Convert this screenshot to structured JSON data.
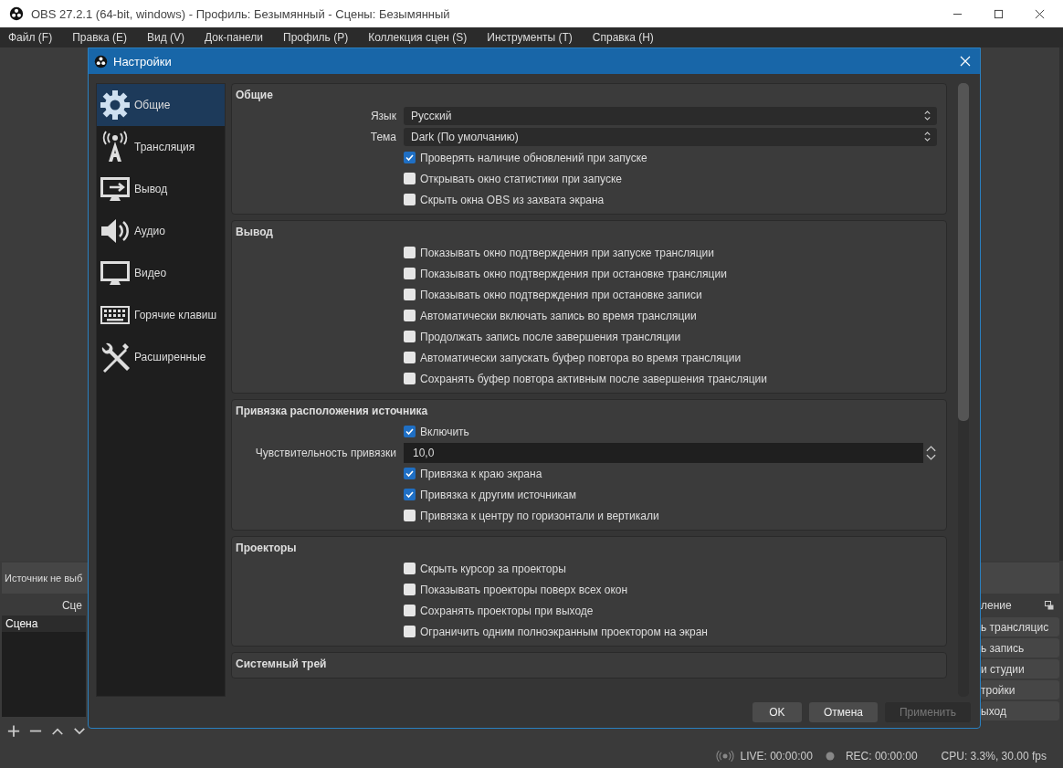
{
  "window": {
    "title": "OBS 27.2.1 (64-bit, windows) - Профиль: Безымянный - Сцены: Безымянный"
  },
  "menu": [
    "Файл (F)",
    "Правка (E)",
    "Вид (V)",
    "Док-панели",
    "Профиль (P)",
    "Коллекция сцен (S)",
    "Инструменты (T)",
    "Справка (H)"
  ],
  "source_bar": {
    "text": "Источник не выб"
  },
  "scenes_panel": {
    "header": "Сце",
    "items": [
      {
        "label": "Сцена",
        "selected": true
      }
    ]
  },
  "controls_panel": {
    "header": "ление",
    "buttons": [
      "ь трансляцис",
      "ь запись",
      "и студии",
      "тройки",
      "ыход"
    ]
  },
  "status_bar": {
    "live": "LIVE: 00:00:00",
    "rec": "REC: 00:00:00",
    "cpu": "CPU: 3.3%, 30.00 fps"
  },
  "dialog": {
    "title": "Настройки",
    "sidebar": [
      {
        "label": "Общие",
        "kind": "gear",
        "selected": true
      },
      {
        "label": "Трансляция",
        "kind": "antenna",
        "selected": false
      },
      {
        "label": "Вывод",
        "kind": "output",
        "selected": false
      },
      {
        "label": "Аудио",
        "kind": "audio",
        "selected": false
      },
      {
        "label": "Видео",
        "kind": "video",
        "selected": false
      },
      {
        "label": "Горячие клавиш",
        "kind": "keyboard",
        "selected": false
      },
      {
        "label": "Расширенные",
        "kind": "tools",
        "selected": false
      }
    ],
    "sections": [
      {
        "title": "Общие",
        "rows": [
          {
            "kind": "select",
            "label": "Язык",
            "value": "Русский"
          },
          {
            "kind": "select",
            "label": "Тема",
            "value": "Dark (По умолчанию)"
          },
          {
            "kind": "checkbox",
            "label": "Проверять наличие обновлений при запуске",
            "checked": true
          },
          {
            "kind": "checkbox",
            "label": "Открывать окно статистики при запуске",
            "checked": false
          },
          {
            "kind": "checkbox",
            "label": "Скрыть окна OBS из захвата экрана",
            "checked": false
          }
        ]
      },
      {
        "title": "Вывод",
        "rows": [
          {
            "kind": "checkbox",
            "label": "Показывать окно подтверждения при запуске трансляции",
            "checked": false
          },
          {
            "kind": "checkbox",
            "label": "Показывать окно подтверждения при остановке трансляции",
            "checked": false
          },
          {
            "kind": "checkbox",
            "label": "Показывать окно подтверждения при остановке записи",
            "checked": false
          },
          {
            "kind": "checkbox",
            "label": "Автоматически включать запись во время трансляции",
            "checked": false
          },
          {
            "kind": "checkbox",
            "label": "Продолжать запись после завершения трансляции",
            "checked": false
          },
          {
            "kind": "checkbox",
            "label": "Автоматически запускать буфер повтора во время трансляции",
            "checked": false
          },
          {
            "kind": "checkbox",
            "label": "Сохранять буфер повтора активным после завершения трансляции",
            "checked": false
          }
        ]
      },
      {
        "title": "Привязка расположения источника",
        "rows": [
          {
            "kind": "checkbox",
            "label": "Включить",
            "checked": true
          },
          {
            "kind": "spin",
            "label": "Чувствительность привязки",
            "value": "10,0"
          },
          {
            "kind": "checkbox",
            "label": "Привязка к краю экрана",
            "checked": true
          },
          {
            "kind": "checkbox",
            "label": "Привязка к другим источникам",
            "checked": true
          },
          {
            "kind": "checkbox",
            "label": "Привязка к центру по горизонтали и вертикали",
            "checked": false
          }
        ]
      },
      {
        "title": "Проекторы",
        "rows": [
          {
            "kind": "checkbox",
            "label": "Скрыть курсор за проекторы",
            "checked": false
          },
          {
            "kind": "checkbox",
            "label": "Показывать проекторы поверх всех окон",
            "checked": false
          },
          {
            "kind": "checkbox",
            "label": "Сохранять проекторы при выходе",
            "checked": false
          },
          {
            "kind": "checkbox",
            "label": "Ограничить одним полноэкранным проектором на экран",
            "checked": false
          }
        ]
      },
      {
        "title": "Системный трей"
      }
    ],
    "buttons": [
      {
        "label": "OK",
        "disabled": false
      },
      {
        "label": "Отмена",
        "disabled": false
      },
      {
        "label": "Применить",
        "disabled": true
      }
    ]
  }
}
